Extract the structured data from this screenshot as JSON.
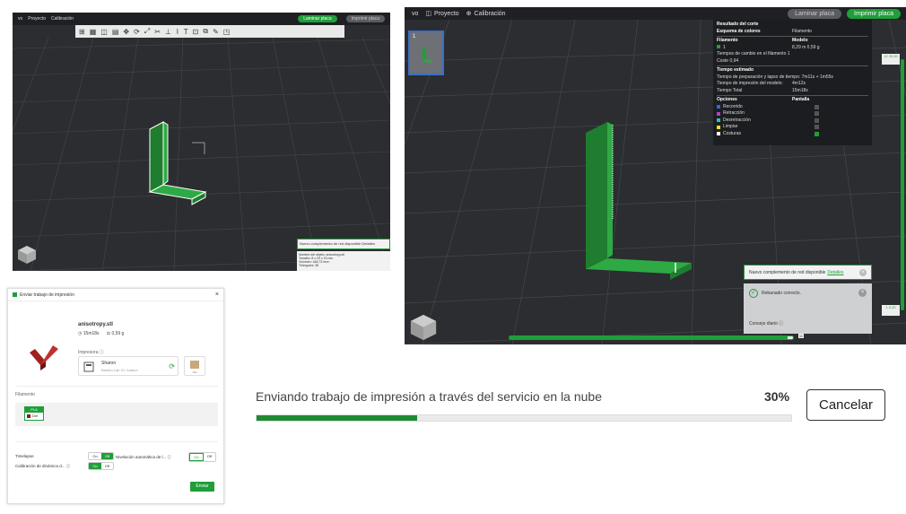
{
  "panel1": {
    "menu": {
      "item1": "vo",
      "item2": "Proyecto",
      "item3": "Calibración"
    },
    "buttons": {
      "slice": "Laminar placa",
      "print": "Imprimir placa"
    },
    "notification": "Nuevo complemento de red disponible Detalles",
    "slice_info": [
      "Nombre del objeto: anisotropy.stl",
      "Tamaño: 8 x 20 x 20 mm",
      "Volumen: 448,73 mm³",
      "Triángulos: 38"
    ]
  },
  "panel2": {
    "menu": {
      "item1": "vo",
      "item2": "Proyecto",
      "item3": "Calibración"
    },
    "buttons": {
      "slice": "Laminar placa",
      "print": "Imprimir placa"
    },
    "plate_number": "1",
    "stats": {
      "title": "Resultado del corte",
      "scheme_label": "Esquema de colores",
      "scheme_value": "Filamento",
      "col_filament": "Filamento",
      "col_model": "Modelo",
      "fil_index": "1",
      "fil_values": "8,29 m   0,59 g",
      "changes_label": "Tiempos de cambio en el filamento",
      "changes_value": "1",
      "cost": "Coste   0,94",
      "time_title": "Tiempo estimado",
      "prep_time": "Tiempo de preparación y lapso de tiempo: 7m11s + 1m55s",
      "print_time_label": "Tiempo de impresión del modelo:",
      "print_time_value": "4m12s",
      "total_label": "Tiempo Total",
      "total_value": "15m18s",
      "opt_header": "Opciones",
      "disp_header": "Pantalla",
      "legend": [
        {
          "label": "Recorrido",
          "color": "#2a6be0"
        },
        {
          "label": "Retracción",
          "color": "#c039c0"
        },
        {
          "label": "Desretracción",
          "color": "#2ec0c0"
        },
        {
          "label": "Limpiar",
          "color": "#f0e020"
        },
        {
          "label": "Costuras",
          "color": "#ffffff"
        }
      ]
    },
    "vslider_top": "12\n20,00",
    "vslider_bot": "1\n0,20",
    "hslider_value": "11",
    "hslider_fill_fraction": 0.98,
    "notification": "Nuevo complemento de red disponible",
    "notification_link": "Detalles",
    "toast_ok": "Rebanado correcto.",
    "toast_tips": "Consejo diario ⓘ"
  },
  "dialog": {
    "title": "Enviar trabajo de impresión",
    "file": "anisotropy.stl",
    "time": "15m18s",
    "weight": "0,59 g",
    "printer_label": "Impresora ⓘ",
    "printer_name": "Sharon",
    "printer_sub": "Bambu Lab X1 Carbon",
    "plate_label": "PEI",
    "filament_label": "Filamento",
    "fil_chip_top": "PLA",
    "fil_chip_bot": "Def",
    "opt1": "Timelapse",
    "opt2": "Nivelación automática de l... ⓘ",
    "opt3": "Calibración de dinámica d... ⓘ",
    "on": "On",
    "off": "Off",
    "send": "Enviar"
  },
  "progress": {
    "label": "Enviando trabajo de impresión a través del servicio en la nube",
    "percent": "30%",
    "fill_fraction": 0.3,
    "cancel": "Cancelar"
  },
  "colors": {
    "accent": "#1f9e3a",
    "viewport": "#2b2d30"
  }
}
